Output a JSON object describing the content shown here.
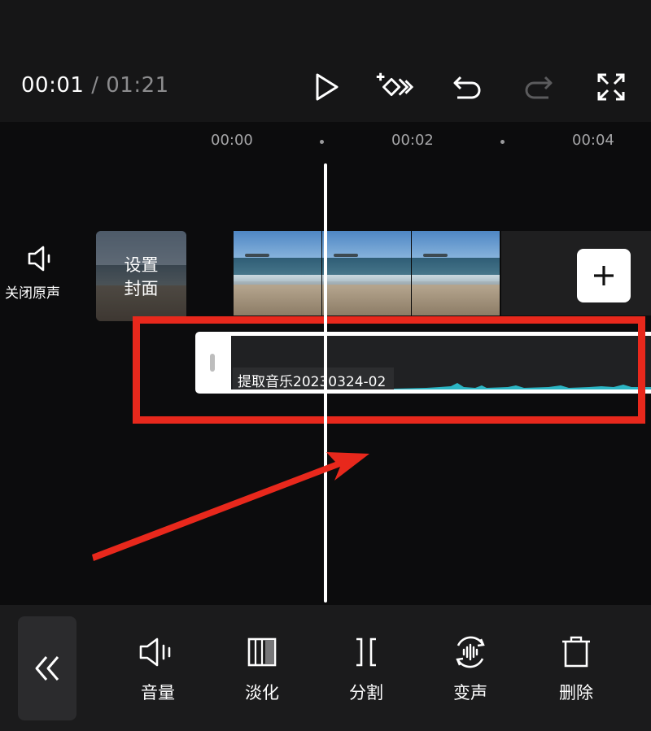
{
  "header": {
    "current_time": "00:01",
    "separator": " / ",
    "total_time": "01:21",
    "buttons": [
      {
        "name": "play-icon"
      },
      {
        "name": "keyframe-icon"
      },
      {
        "name": "undo-icon"
      },
      {
        "name": "redo-icon",
        "disabled": true
      },
      {
        "name": "fullscreen-icon"
      }
    ]
  },
  "ruler": {
    "ticks": [
      "00:00",
      "00:02",
      "00:04"
    ]
  },
  "timeline": {
    "mute_original_label": "关闭原声",
    "cover_label_line1": "设置",
    "cover_label_line2": "封面",
    "add_clip_icon": "plus-icon",
    "audio_clip_label": "提取音乐20230324-02"
  },
  "colors": {
    "background": "#0c0c0d",
    "highlight": "#e8281c",
    "waveform": "#2bb5c4",
    "panel": "#1b1b1c"
  },
  "toolbar": {
    "back_icon": "double-chevron-left-icon",
    "items": [
      {
        "label": "音量",
        "icon": "volume-icon"
      },
      {
        "label": "淡化",
        "icon": "fade-icon"
      },
      {
        "label": "分割",
        "icon": "split-icon"
      },
      {
        "label": "变声",
        "icon": "voice-change-icon"
      },
      {
        "label": "删除",
        "icon": "delete-icon"
      }
    ]
  }
}
